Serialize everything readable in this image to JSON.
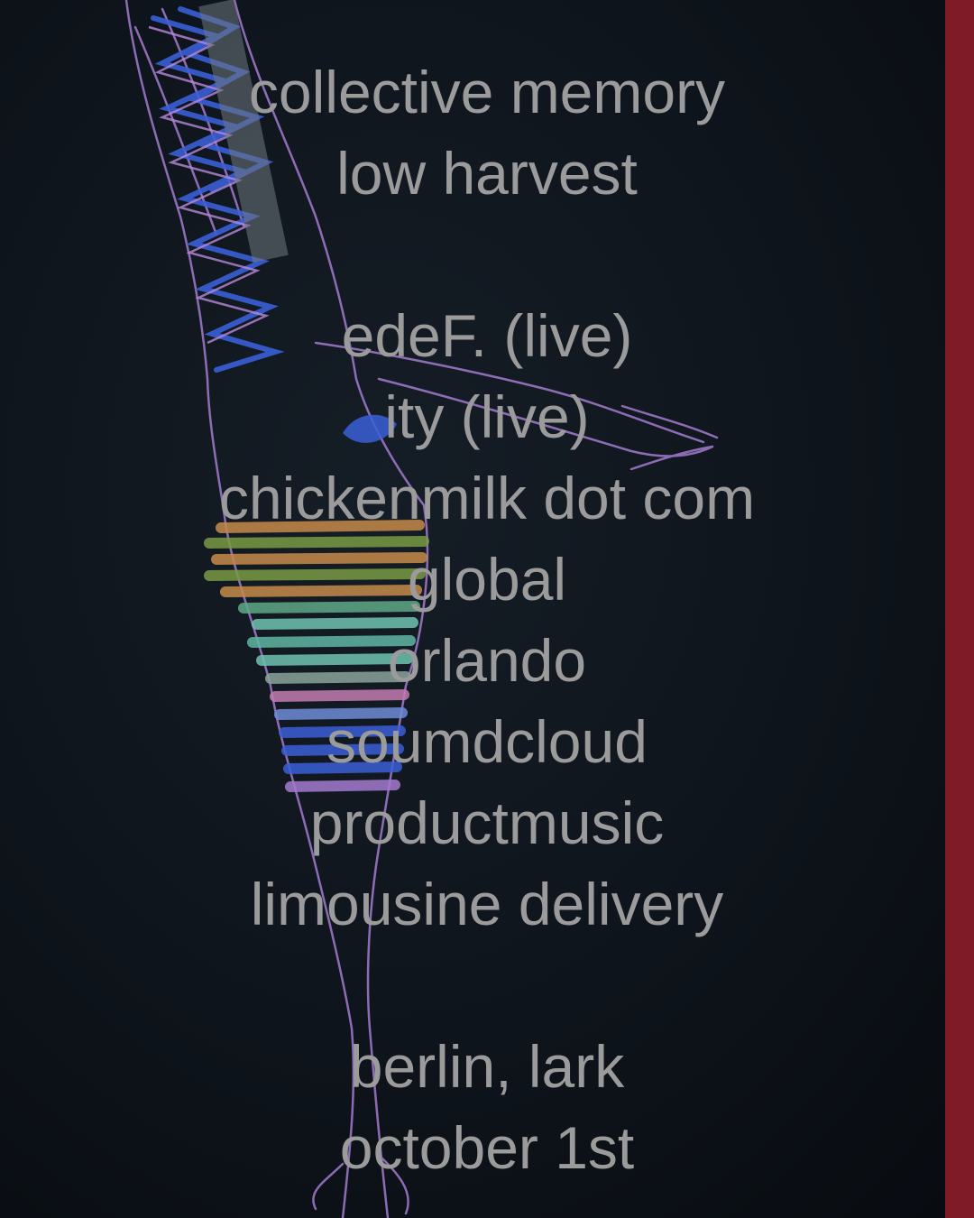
{
  "poster": {
    "accent_color": "#7e1b27",
    "text_color": "#9b9b9b",
    "background_color": "#0e141b",
    "headliners": [
      "collective memory",
      "low harvest"
    ],
    "lineup": [
      "edeF. (live)",
      "ity (live)",
      "chickenmilk dot com",
      "global",
      "orlando",
      "soumdcloud",
      "productmusic",
      "limousine delivery"
    ],
    "venue": "berlin, lark",
    "date": "october 1st",
    "artwork": "crayon drawing of a tall figure with blue zigzag pattern and rainbow striped band"
  }
}
